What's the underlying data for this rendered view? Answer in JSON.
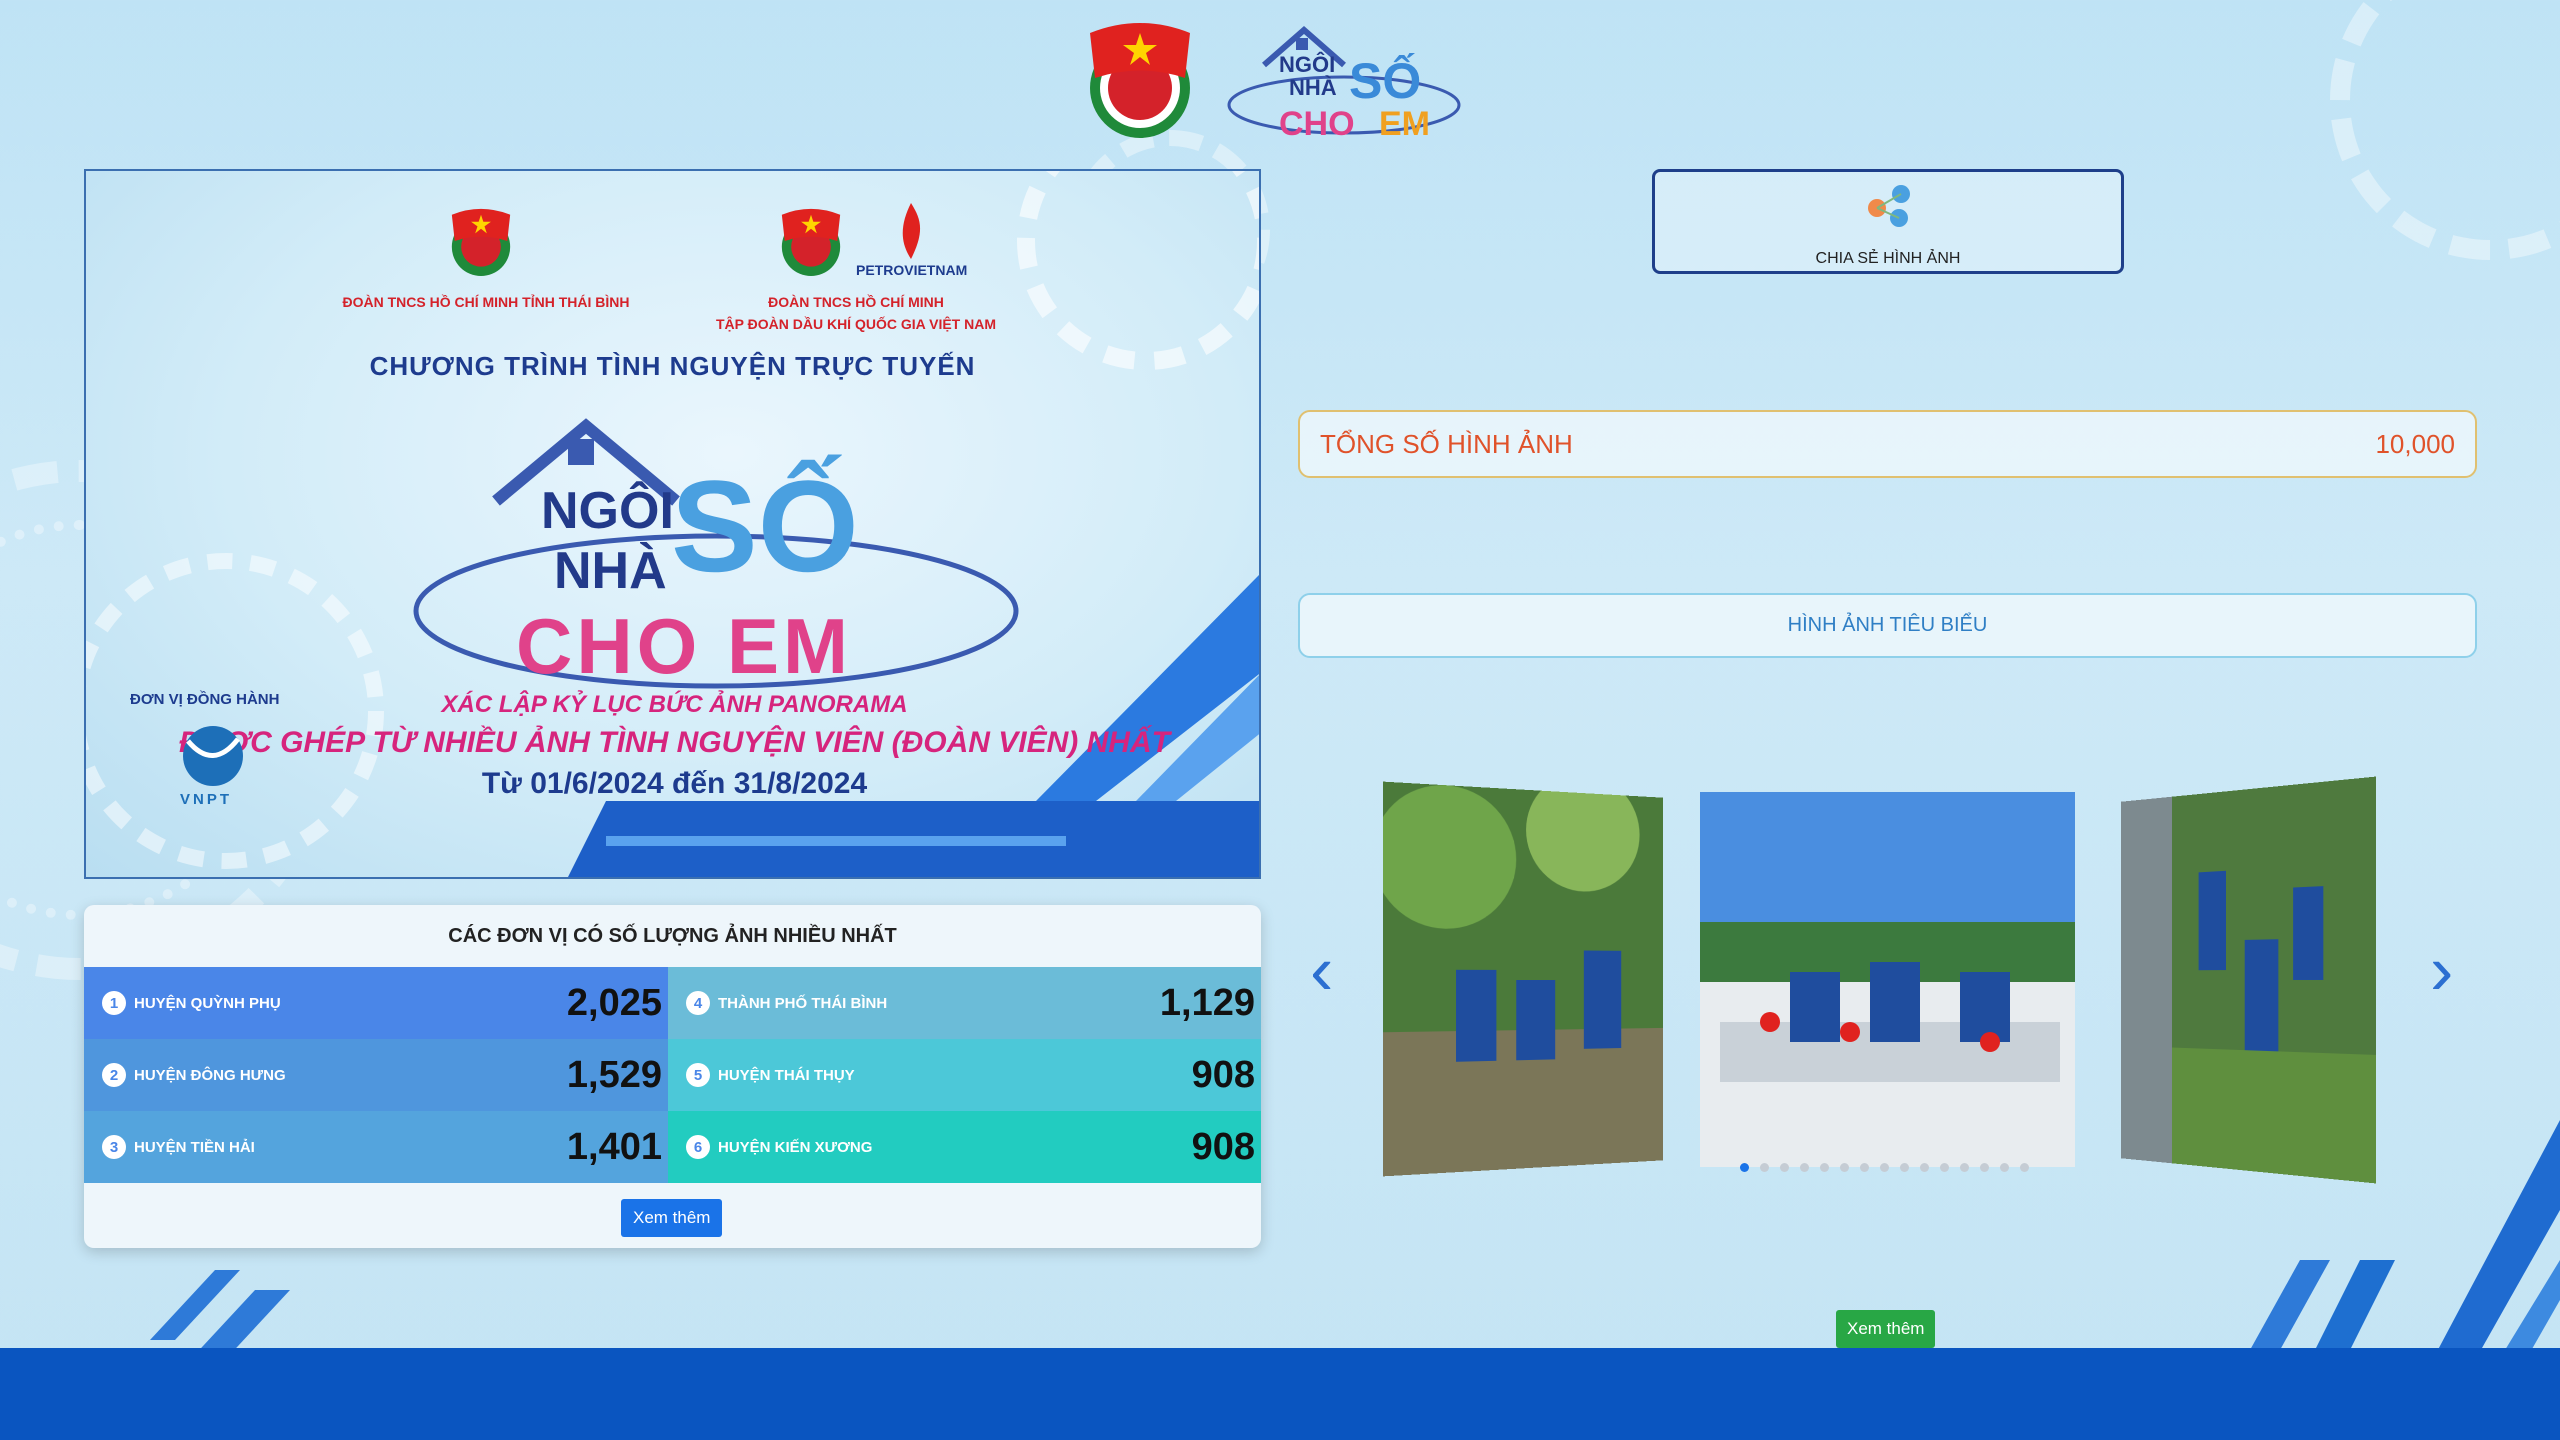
{
  "banner": {
    "org_left": "ĐOÀN TNCS HỒ CHÍ MINH TỈNH THÁI BÌNH",
    "org_right_1": "ĐOÀN TNCS HỒ CHÍ MINH",
    "org_right_2": "TẬP ĐOÀN DẦU KHÍ QUỐC GIA VIỆT NAM",
    "petro": "PETROVIETNAM",
    "program": "CHƯƠNG TRÌNH TÌNH NGUYỆN TRỰC TUYẾN",
    "logo_ngoi": "NGÔI",
    "logo_nha": "NHÀ",
    "logo_so": "SỐ",
    "logo_cho_em": "CHO EM",
    "record_1": "XÁC LẬP KỶ LỤC BỨC ẢNH PANORAMA",
    "record_2": "ĐƯỢC GHÉP TỪ NHIỀU ẢNH TÌNH NGUYỆN VIÊN (ĐOÀN VIÊN) NHẤT",
    "dates": "Từ 01/6/2024 đến 31/8/2024",
    "sponsor_label": "ĐƠN VỊ ĐỒNG HÀNH",
    "sponsor_name": "VNPT"
  },
  "leaderboard": {
    "title": "CÁC ĐƠN VỊ CÓ SỐ LƯỢNG ẢNH NHIỀU NHẤT",
    "rows": [
      {
        "rank": "1",
        "name": "HUYỆN QUỲNH PHỤ",
        "count": "2,025",
        "color": "#4a86e8"
      },
      {
        "rank": "4",
        "name": "THÀNH PHỐ THÁI BÌNH",
        "count": "1,129",
        "color": "#6bbcd8"
      },
      {
        "rank": "2",
        "name": "HUYỆN ĐÔNG HƯNG",
        "count": "1,529",
        "color": "#4f96dd"
      },
      {
        "rank": "5",
        "name": "HUYỆN THÁI THỤY",
        "count": "908",
        "color": "#4cc8d8"
      },
      {
        "rank": "3",
        "name": "HUYỆN TIỀN HẢI",
        "count": "1,401",
        "color": "#54a4dd"
      },
      {
        "rank": "6",
        "name": "HUYỆN KIẾN XƯƠNG",
        "count": "908",
        "color": "#22ccc0"
      }
    ],
    "more_label": "Xem thêm"
  },
  "share": {
    "label": "CHIA SẺ HÌNH ẢNH"
  },
  "total": {
    "label": "TỔNG SỐ HÌNH ẢNH",
    "value": "10,000"
  },
  "featured": {
    "label": "HÌNH ẢNH TIÊU BIỂU"
  },
  "carousel": {
    "slide_count": 15,
    "active_index": 0
  },
  "more_green_label": "Xem thêm",
  "colors": {
    "accent": "#1a73e8",
    "brand_dark": "#1e3f8a",
    "total_text": "#e0522a",
    "green": "#28a745"
  }
}
